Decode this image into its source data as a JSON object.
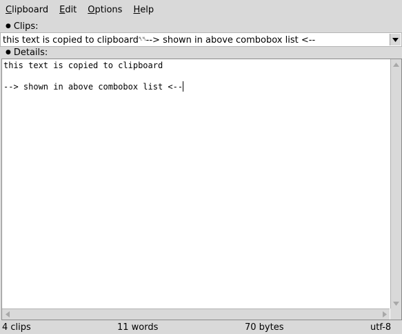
{
  "menubar": {
    "items": [
      {
        "label": "Clipboard",
        "mnemonic": "C",
        "rest": "lipboard"
      },
      {
        "label": "Edit",
        "mnemonic": "E",
        "rest": "dit"
      },
      {
        "label": "Options",
        "mnemonic": "O",
        "rest": "ptions"
      },
      {
        "label": "Help",
        "mnemonic": "H",
        "rest": "elp"
      }
    ]
  },
  "clips": {
    "section_label": "Clips:",
    "selected_before": "this text is copied to clipboard",
    "newline_glyph": "␤␤",
    "selected_after": "--> shown in above combobox list <--"
  },
  "details": {
    "section_label": "Details:",
    "line1": "this text is copied to clipboard",
    "line2": "",
    "line3": "--> shown in above combobox list <--"
  },
  "status": {
    "clips": "4 clips",
    "words": "11 words",
    "bytes": "70 bytes",
    "encoding": "utf-8"
  }
}
